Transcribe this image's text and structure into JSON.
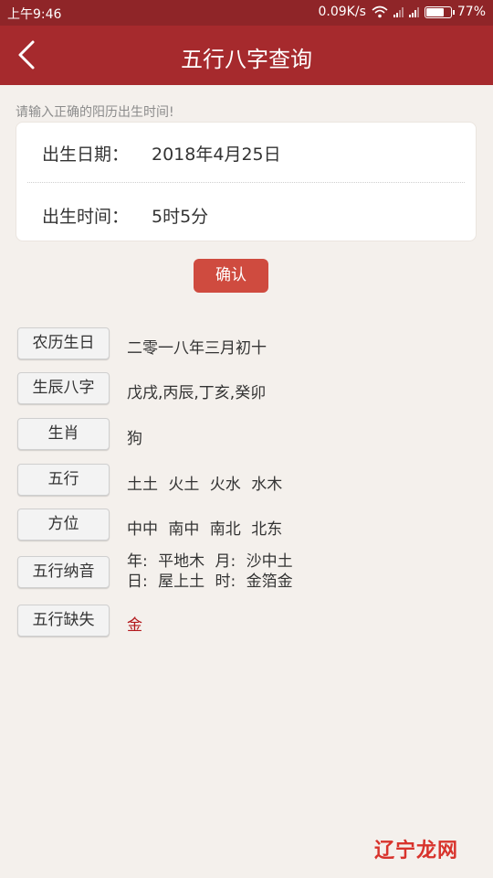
{
  "status_bar": {
    "time": "上午9:46",
    "speed": "0.09K/s",
    "battery_text": "77%",
    "battery_level": 0.77
  },
  "header": {
    "title": "五行八字查询"
  },
  "form": {
    "hint": "请输入正确的阳历出生时间!",
    "birth_date_label": "出生日期：",
    "birth_date_value": "2018年4月25日",
    "birth_time_label": "出生时间：",
    "birth_time_value": "5时5分",
    "confirm_label": "确认"
  },
  "results": [
    {
      "label": "农历生日",
      "value": "二零一八年三月初十"
    },
    {
      "label": "生辰八字",
      "value": "戊戌,丙辰,丁亥,癸卯"
    },
    {
      "label": "生肖",
      "value": "狗"
    },
    {
      "label": "五行",
      "value": "土土 火土 火水 水木"
    },
    {
      "label": "方位",
      "value": "中中 南中 南北 北东"
    },
    {
      "label": "五行纳音",
      "line1": "年: 平地木  月: 沙中土",
      "line2": "日: 屋上土  时: 金箔金"
    },
    {
      "label": "五行缺失",
      "value": "金"
    }
  ],
  "watermark": "辽宁龙网",
  "colors": {
    "header": "#a62a2d",
    "status_bar": "#8f2528",
    "confirm": "#cf4b3f",
    "missing_value": "#b3191d"
  }
}
